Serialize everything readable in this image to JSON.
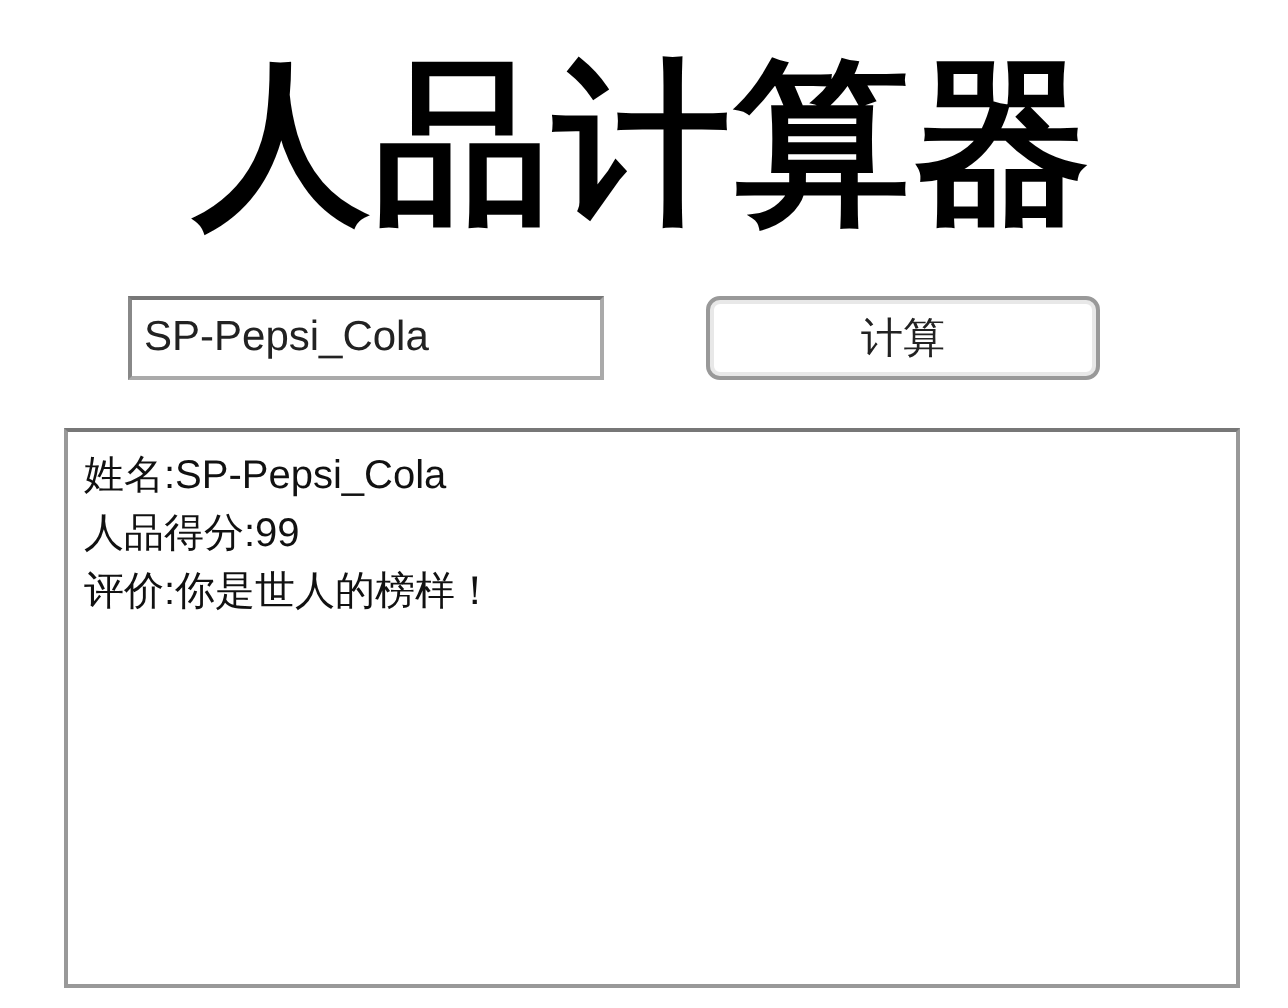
{
  "title": "人品计算器",
  "name_input": {
    "value": "SP-Pepsi_Cola"
  },
  "calculate_button": {
    "label": "计算"
  },
  "result_lines": [
    "姓名:SP-Pepsi_Cola",
    "人品得分:99",
    "评价:你是世人的榜样！"
  ]
}
